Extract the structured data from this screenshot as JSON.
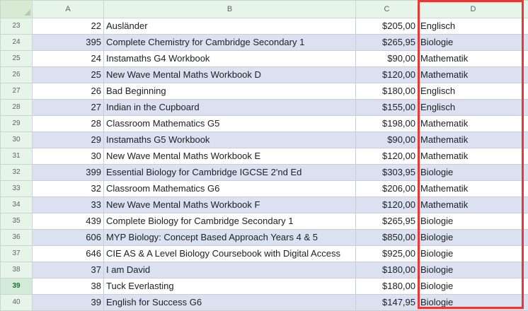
{
  "columns": [
    "A",
    "B",
    "C",
    "D"
  ],
  "highlight_color": "#e53935",
  "band_color": "#dbe1f1",
  "header_color": "#e6f4ea",
  "selected_row": "39",
  "rows": [
    {
      "row": "23",
      "a": "22",
      "b": "Ausländer",
      "c": "$205,00",
      "d": "Englisch"
    },
    {
      "row": "24",
      "a": "395",
      "b": "Complete Chemistry for Cambridge Secondary 1",
      "c": "$265,95",
      "d": "Biologie"
    },
    {
      "row": "25",
      "a": "24",
      "b": "Instamaths G4 Workbook",
      "c": "$90,00",
      "d": "Mathematik"
    },
    {
      "row": "26",
      "a": "25",
      "b": "New Wave Mental Maths Workbook D",
      "c": "$120,00",
      "d": "Mathematik"
    },
    {
      "row": "27",
      "a": "26",
      "b": "Bad Beginning",
      "c": "$180,00",
      "d": "Englisch"
    },
    {
      "row": "28",
      "a": "27",
      "b": "Indian in the Cupboard",
      "c": "$155,00",
      "d": "Englisch"
    },
    {
      "row": "29",
      "a": "28",
      "b": "Classroom Mathematics G5",
      "c": "$198,00",
      "d": "Mathematik"
    },
    {
      "row": "30",
      "a": "29",
      "b": "Instamaths G5 Workbook",
      "c": "$90,00",
      "d": "Mathematik"
    },
    {
      "row": "31",
      "a": "30",
      "b": "New Wave Mental Maths Workbook E",
      "c": "$120,00",
      "d": "Mathematik"
    },
    {
      "row": "32",
      "a": "399",
      "b": "Essential Biology for Cambridge IGCSE 2'nd Ed",
      "c": "$303,95",
      "d": "Biologie"
    },
    {
      "row": "33",
      "a": "32",
      "b": "Classroom Mathematics G6",
      "c": "$206,00",
      "d": "Mathematik"
    },
    {
      "row": "34",
      "a": "33",
      "b": "New Wave Mental Maths Workbook F",
      "c": "$120,00",
      "d": "Mathematik"
    },
    {
      "row": "35",
      "a": "439",
      "b": "Complete Biology for Cambridge Secondary 1",
      "c": "$265,95",
      "d": "Biologie"
    },
    {
      "row": "36",
      "a": "606",
      "b": "MYP Biology: Concept Based Approach Years 4 & 5",
      "c": "$850,00",
      "d": "Biologie"
    },
    {
      "row": "37",
      "a": "646",
      "b": "CIE AS & A Level Biology Coursebook with Digital Access",
      "c": "$925,00",
      "d": "Biologie"
    },
    {
      "row": "38",
      "a": "37",
      "b": "I am David",
      "c": "$180,00",
      "d": "Biologie"
    },
    {
      "row": "39",
      "a": "38",
      "b": "Tuck Everlasting",
      "c": "$180,00",
      "d": "Biologie"
    },
    {
      "row": "40",
      "a": "39",
      "b": "English for Success G6",
      "c": "$147,95",
      "d": "Biologie"
    }
  ]
}
